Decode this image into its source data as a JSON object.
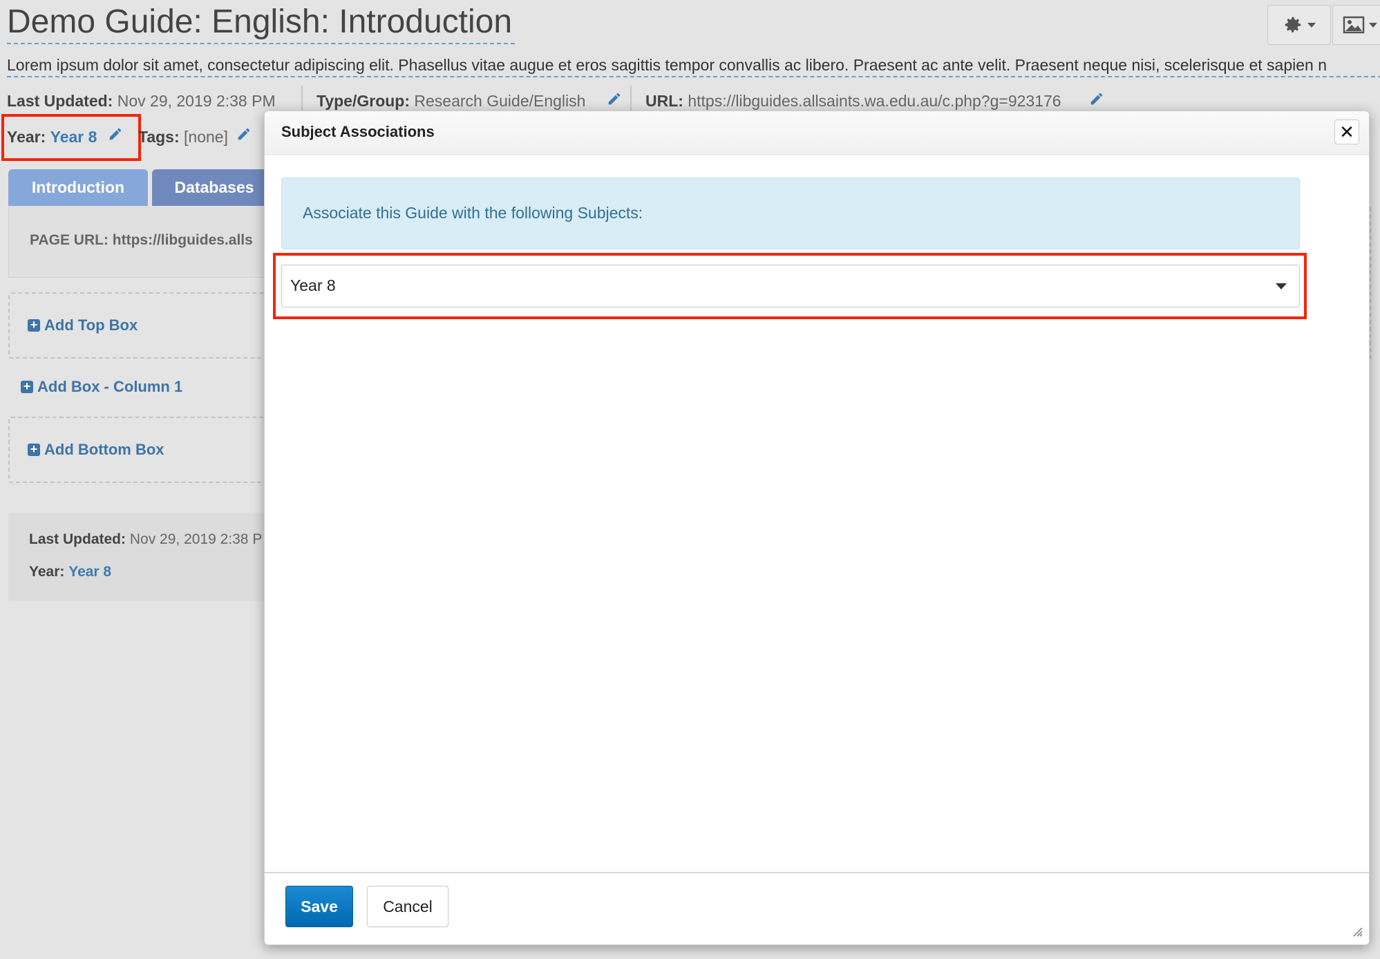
{
  "page": {
    "title": "Demo Guide: English: Introduction",
    "description": "Lorem ipsum dolor sit amet, consectetur adipiscing elit. Phasellus vitae augue et eros sagittis tempor convallis ac libero. Praesent ac ante velit. Praesent neque nisi, scelerisque et sapien n",
    "meta": {
      "last_updated_label": "Last Updated:",
      "last_updated_value": "Nov 29, 2019 2:38 PM",
      "type_group_label": "Type/Group:",
      "type_group_value": "Research Guide/English",
      "url_label": "URL:",
      "url_value": "https://libguides.allsaints.wa.edu.au/c.php?g=923176",
      "year_label": "Year:",
      "year_value": "Year 8",
      "tags_label": "Tags:",
      "tags_value": "[none]"
    },
    "tabs": [
      {
        "label": "Introduction"
      },
      {
        "label": "Databases"
      }
    ],
    "page_url_label": "PAGE URL: https://libguides.alls",
    "add_top_box": "Add Top Box",
    "add_box_column": "Add Box - Column 1",
    "add_bottom_box": "Add Bottom Box",
    "footer": {
      "last_updated_label": "Last Updated:",
      "last_updated_value": "Nov 29, 2019 2:38 P",
      "year_label": "Year:",
      "year_value": "Year 8"
    }
  },
  "toolbar": {
    "icons": [
      "gear-icon",
      "image-icon"
    ]
  },
  "modal": {
    "title": "Subject Associations",
    "close_icon": "close-icon",
    "info_text": "Associate this Guide with the following Subjects:",
    "subjects_select": {
      "selected_value": "Year 8"
    },
    "save_label": "Save",
    "cancel_label": "Cancel"
  },
  "colors": {
    "accent_link": "#3c7bb3",
    "highlight": "#f2260a",
    "save_button": "#0a78c2",
    "info_bg": "#d9edf7",
    "info_text": "#31708f",
    "tab_active": "#7b9fd6",
    "tab_inactive": "#6b85b8"
  }
}
